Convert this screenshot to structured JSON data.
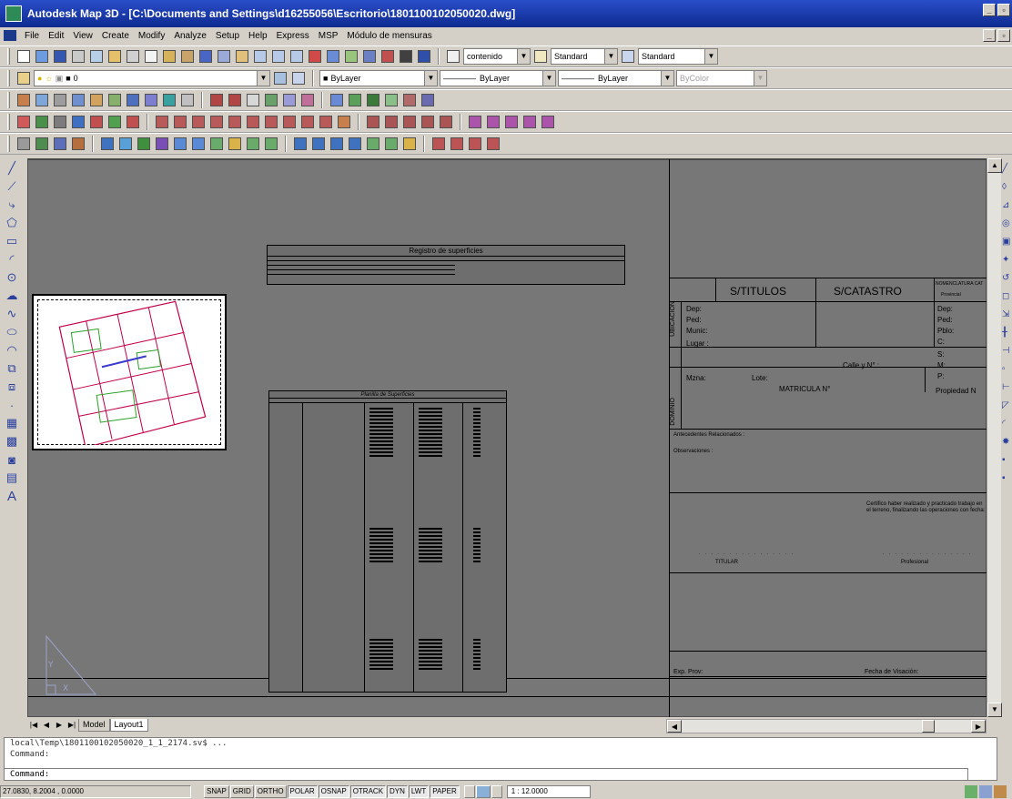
{
  "window": {
    "title": "Autodesk Map 3D - [C:\\Documents and Settings\\d16255056\\Escritorio\\1801100102050020.dwg]"
  },
  "menu": [
    "File",
    "Edit",
    "View",
    "Create",
    "Modify",
    "Analyze",
    "Setup",
    "Help",
    "Express",
    "MSP",
    "Módulo de mensuras"
  ],
  "toolbar_styles": {
    "text_style": "contenido",
    "dim_style": "Standard",
    "table_style": "Standard"
  },
  "layers_toolbar": {
    "layer": "0",
    "color": "ByLayer",
    "linetype": "ByLayer",
    "lineweight": "ByLayer",
    "plotstyle": "ByColor"
  },
  "drawing": {
    "table1_title": "Registro de superficies",
    "table2_title": "Planilla de Superficies",
    "form": {
      "s_titulos": "S/TITULOS",
      "s_catastro": "S/CATASTRO",
      "nomenclatura": "NOMENCLATURA CAT",
      "provincial": "Provincial",
      "ubicacion": "UBICACION",
      "dep": "Dep:",
      "ped": "Ped:",
      "munic": "Munic:",
      "pblo": "Pblo:",
      "lugar": "Lugar :",
      "calle": "Calle y N° :",
      "mzna": "Mzna:",
      "lote": "Lote:",
      "matricula": "MATRICULA  N°",
      "propiedad": "Propiedad N",
      "dominio": "DOMINIO",
      "antecedentes": "Antecedentes Relacionados :",
      "observaciones": "Observaciones :",
      "certifico": "Certifico haber realizado y  practicado trabajo en el terreno, finalizando las operaciones con fecha:",
      "titular": "TITULAR",
      "profesional": "Profesional",
      "exp_prov": "Exp. Prov:",
      "fecha_visacion": "Fecha de Visación:",
      "c_label": "C:",
      "s_label": "S:",
      "m_label": "M:",
      "p_label": "P:",
      "dep2": "Dep:",
      "ped2": "Ped:"
    }
  },
  "tabs": [
    "Model",
    "Layout1"
  ],
  "command": {
    "history1": "local\\Temp\\1801100102050020_1_1_2174.sv$ ...",
    "history2": "Command:",
    "prompt": "Command:"
  },
  "status": {
    "coords": "27.0830, 8.2004 , 0.0000",
    "buttons": [
      "SNAP",
      "GRID",
      "ORTHO",
      "POLAR",
      "OSNAP",
      "OTRACK",
      "DYN",
      "LWT",
      "PAPER"
    ],
    "scale": "1 : 12.0000"
  }
}
